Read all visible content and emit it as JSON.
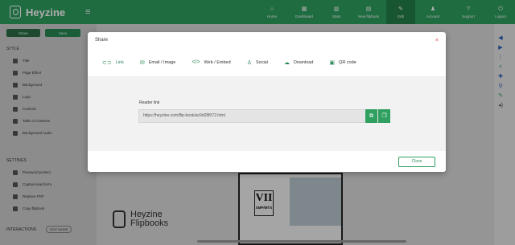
{
  "app": {
    "name": "Heyzine",
    "menu_glyph": "≡"
  },
  "nav": [
    {
      "label": "Home",
      "icon": "⌂"
    },
    {
      "label": "Dashboard",
      "icon": "▦"
    },
    {
      "label": "Stats",
      "icon": "▥"
    },
    {
      "label": "New flipbook",
      "icon": "▤"
    },
    {
      "label": "Edit",
      "icon": "✎"
    },
    {
      "label": "Account",
      "icon": "♟"
    },
    {
      "label": "Support",
      "icon": "?"
    },
    {
      "label": "Logout",
      "icon": "⏻"
    }
  ],
  "sidebar": {
    "top_buttons": [
      "Share",
      "Save"
    ],
    "style_header": "STYLE",
    "style_items": [
      "Title",
      "Page Effect",
      "Background",
      "Logo",
      "Controls",
      "Table of contents",
      "Background Audio"
    ],
    "settings_header": "SETTINGS",
    "settings_items": [
      "Password protect",
      "Capture lead form",
      "Replace PDF",
      "Copy flipbook"
    ],
    "interactions_header": "INTERACTIONS",
    "interactions_pill": "Edit mode"
  },
  "preview": {
    "watermark_line1": "Heyzine",
    "watermark_line2": "Flipbooks",
    "book_tag_big": "VII",
    "book_tag_small": "SMP/MTS"
  },
  "modal": {
    "title": "Share",
    "close_glyph": "×",
    "tabs": [
      {
        "label": "Link",
        "icon": "⊂⊃"
      },
      {
        "label": "Email / Image",
        "icon": "✉"
      },
      {
        "label": "Web / Embed",
        "icon": "</>"
      },
      {
        "label": "Social",
        "icon": "♙"
      },
      {
        "label": "Download",
        "icon": "☁"
      },
      {
        "label": "QR code",
        "icon": "▣"
      }
    ],
    "field_label": "Reader link",
    "url": "https://heyzine.com/flip-book/ac9d28f072.html",
    "close_button": "Close"
  },
  "colors": {
    "brand": "#2fa060",
    "active_nav": "#247f4b",
    "close_x": "#e24545"
  }
}
